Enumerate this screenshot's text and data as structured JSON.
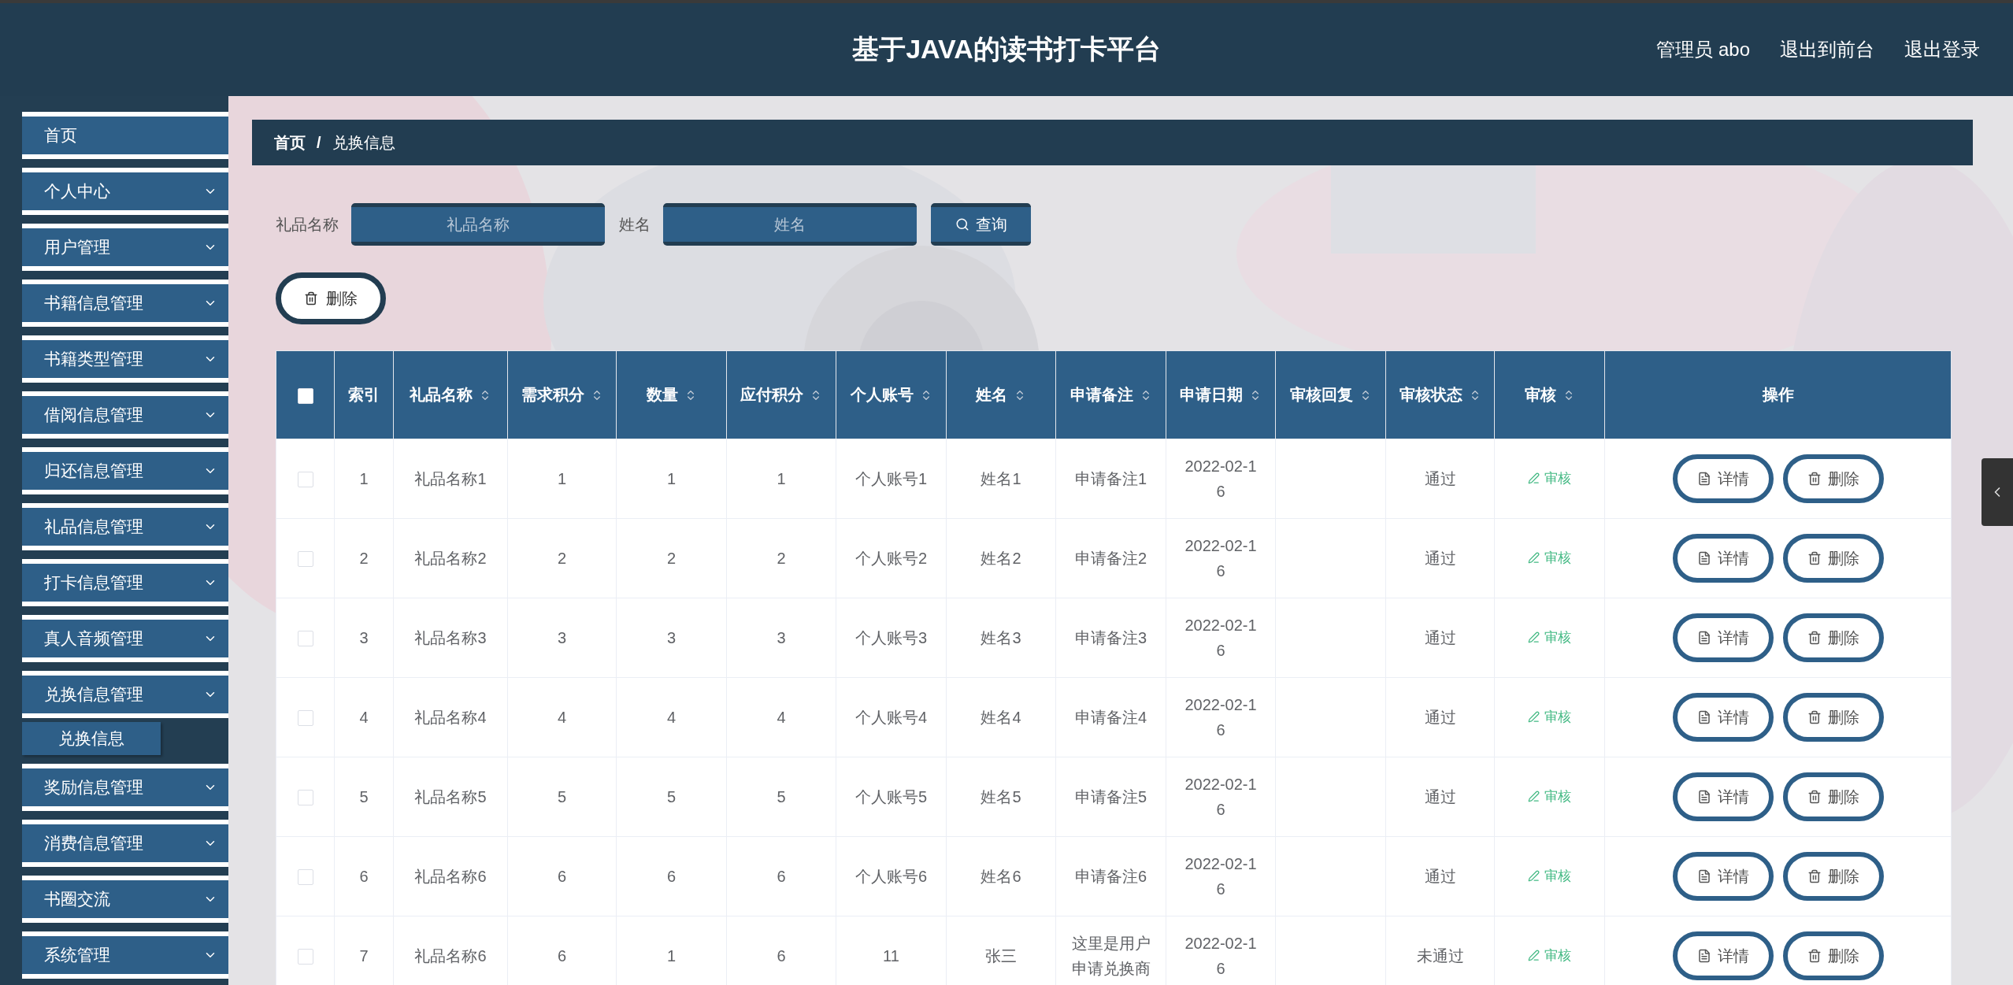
{
  "header": {
    "title": "基于JAVA的读书打卡平台",
    "user": "管理员 abo",
    "links": [
      "退出到前台",
      "退出登录"
    ]
  },
  "sidebar": {
    "items": [
      {
        "label": "首页",
        "kind": "link"
      },
      {
        "label": "个人中心",
        "kind": "menu"
      },
      {
        "label": "用户管理",
        "kind": "menu"
      },
      {
        "label": "书籍信息管理",
        "kind": "menu"
      },
      {
        "label": "书籍类型管理",
        "kind": "menu"
      },
      {
        "label": "借阅信息管理",
        "kind": "menu"
      },
      {
        "label": "归还信息管理",
        "kind": "menu"
      },
      {
        "label": "礼品信息管理",
        "kind": "menu"
      },
      {
        "label": "打卡信息管理",
        "kind": "menu"
      },
      {
        "label": "真人音频管理",
        "kind": "menu"
      },
      {
        "label": "兑换信息管理",
        "kind": "menu",
        "expanded": true,
        "children": [
          {
            "label": "兑换信息",
            "selected": true
          }
        ]
      },
      {
        "label": "奖励信息管理",
        "kind": "menu"
      },
      {
        "label": "消费信息管理",
        "kind": "menu"
      },
      {
        "label": "书圈交流",
        "kind": "menu"
      },
      {
        "label": "系统管理",
        "kind": "menu"
      }
    ]
  },
  "breadcrumb": {
    "separator": "/",
    "items": [
      "首页",
      "兑换信息"
    ]
  },
  "search": {
    "fields": [
      {
        "label": "礼品名称",
        "placeholder": "礼品名称"
      },
      {
        "label": "姓名",
        "placeholder": "姓名"
      }
    ],
    "button": "查询"
  },
  "toolbar": {
    "delete_button": "删除"
  },
  "table": {
    "select_all_checked": false,
    "columns": [
      {
        "label": "索引",
        "sortable": false
      },
      {
        "label": "礼品名称",
        "sortable": true
      },
      {
        "label": "需求积分",
        "sortable": true
      },
      {
        "label": "数量",
        "sortable": true
      },
      {
        "label": "应付积分",
        "sortable": true
      },
      {
        "label": "个人账号",
        "sortable": true
      },
      {
        "label": "姓名",
        "sortable": true
      },
      {
        "label": "申请备注",
        "sortable": true
      },
      {
        "label": "申请日期",
        "sortable": true
      },
      {
        "label": "审核回复",
        "sortable": true
      },
      {
        "label": "审核状态",
        "sortable": true
      },
      {
        "label": "审核",
        "sortable": true
      },
      {
        "label": "操作",
        "sortable": false
      }
    ],
    "rows": [
      {
        "checked": false,
        "cells": [
          "1",
          "礼品名称1",
          "1",
          "1",
          "1",
          "个人账号1",
          "姓名1",
          "申请备注1",
          "2022-02-16",
          null,
          "通过"
        ],
        "review": "审核",
        "actions": [
          "详情",
          "删除"
        ]
      },
      {
        "checked": false,
        "cells": [
          "2",
          "礼品名称2",
          "2",
          "2",
          "2",
          "个人账号2",
          "姓名2",
          "申请备注2",
          "2022-02-16",
          null,
          "通过"
        ],
        "review": "审核",
        "actions": [
          "详情",
          "删除"
        ]
      },
      {
        "checked": false,
        "cells": [
          "3",
          "礼品名称3",
          "3",
          "3",
          "3",
          "个人账号3",
          "姓名3",
          "申请备注3",
          "2022-02-16",
          null,
          "通过"
        ],
        "review": "审核",
        "actions": [
          "详情",
          "删除"
        ]
      },
      {
        "checked": false,
        "cells": [
          "4",
          "礼品名称4",
          "4",
          "4",
          "4",
          "个人账号4",
          "姓名4",
          "申请备注4",
          "2022-02-16",
          null,
          "通过"
        ],
        "review": "审核",
        "actions": [
          "详情",
          "删除"
        ]
      },
      {
        "checked": false,
        "cells": [
          "5",
          "礼品名称5",
          "5",
          "5",
          "5",
          "个人账号5",
          "姓名5",
          "申请备注5",
          "2022-02-16",
          null,
          "通过"
        ],
        "review": "审核",
        "actions": [
          "详情",
          "删除"
        ]
      },
      {
        "checked": false,
        "cells": [
          "6",
          "礼品名称6",
          "6",
          "6",
          "6",
          "个人账号6",
          "姓名6",
          "申请备注6",
          "2022-02-16",
          null,
          "通过"
        ],
        "review": "审核",
        "actions": [
          "详情",
          "删除"
        ]
      },
      {
        "checked": false,
        "cells": [
          "7",
          "礼品名称6",
          "6",
          "1",
          "6",
          "11",
          "张三",
          "这里是用户申请兑换商",
          "2022-02-16",
          null,
          "未通过"
        ],
        "review": "审核",
        "actions": [
          "详情",
          "删除"
        ]
      }
    ]
  }
}
